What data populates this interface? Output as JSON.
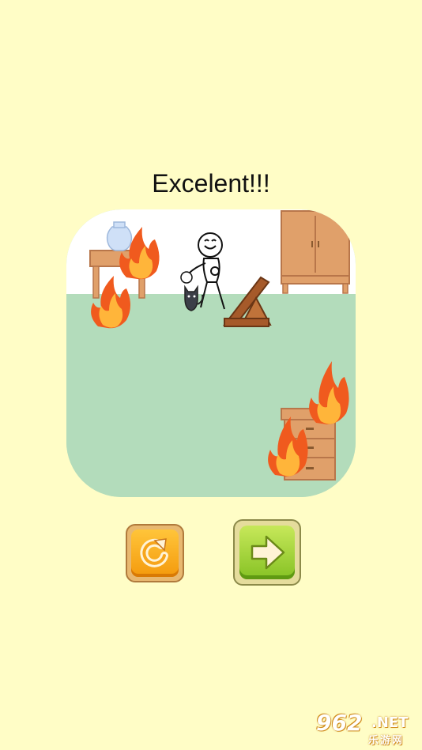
{
  "result": {
    "title": "Excelent!!!"
  },
  "buttons": {
    "retry_icon": "refresh-arrow-icon",
    "next_icon": "arrow-right-icon"
  },
  "colors": {
    "background": "#fffdc6",
    "floor": "#b3dcbb",
    "wall": "#ffffff",
    "retry_button": "#f7a51b",
    "next_button": "#9ccc35",
    "fire_outer": "#f05a1e",
    "fire_inner": "#ffb53a"
  },
  "watermark": {
    "digits": "962",
    "domain": ".NET",
    "label": "乐游网"
  }
}
